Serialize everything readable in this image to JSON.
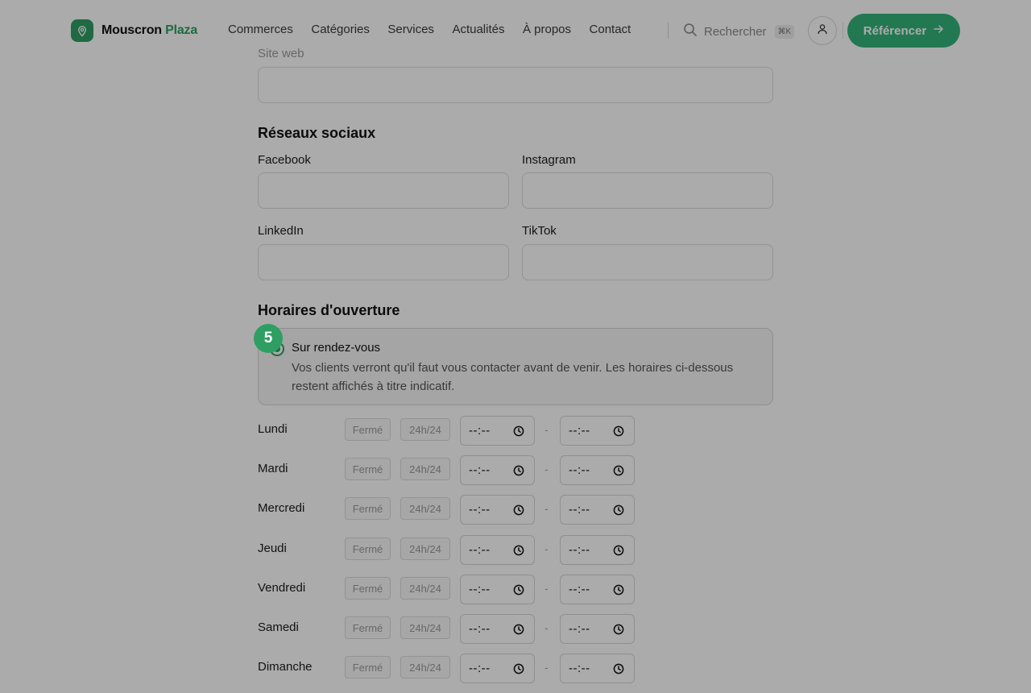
{
  "header": {
    "logo": {
      "part1": "Mouscron",
      "part2": "Plaza"
    },
    "nav": [
      "Commerces",
      "Catégories",
      "Services",
      "Actualités",
      "À propos",
      "Contact"
    ],
    "search": {
      "label": "Rechercher",
      "shortcut": "⌘K"
    },
    "cta": "Référencer"
  },
  "form": {
    "website_label": "Site web",
    "social": {
      "title": "Réseaux sociaux",
      "facebook": "Facebook",
      "instagram": "Instagram",
      "linkedin": "LinkedIn",
      "tiktok": "TikTok"
    },
    "hours": {
      "title": "Horaires d'ouverture",
      "appointment": {
        "title": "Sur rendez-vous",
        "description": "Vos clients verront qu'il faut vous contacter avant de venir. Les horaires ci-dessous restent affichés à titre indicatif."
      },
      "closed_label": "Fermé",
      "allday_label": "24h/24",
      "time_placeholder": "--:--",
      "separator": "-",
      "days": [
        "Lundi",
        "Mardi",
        "Mercredi",
        "Jeudi",
        "Vendredi",
        "Samedi",
        "Dimanche"
      ]
    }
  },
  "step_badge": "5",
  "colors": {
    "brand": "#2f9e63",
    "cta": "#34b37a",
    "overlay": "rgba(0,0,0,0.33)"
  }
}
